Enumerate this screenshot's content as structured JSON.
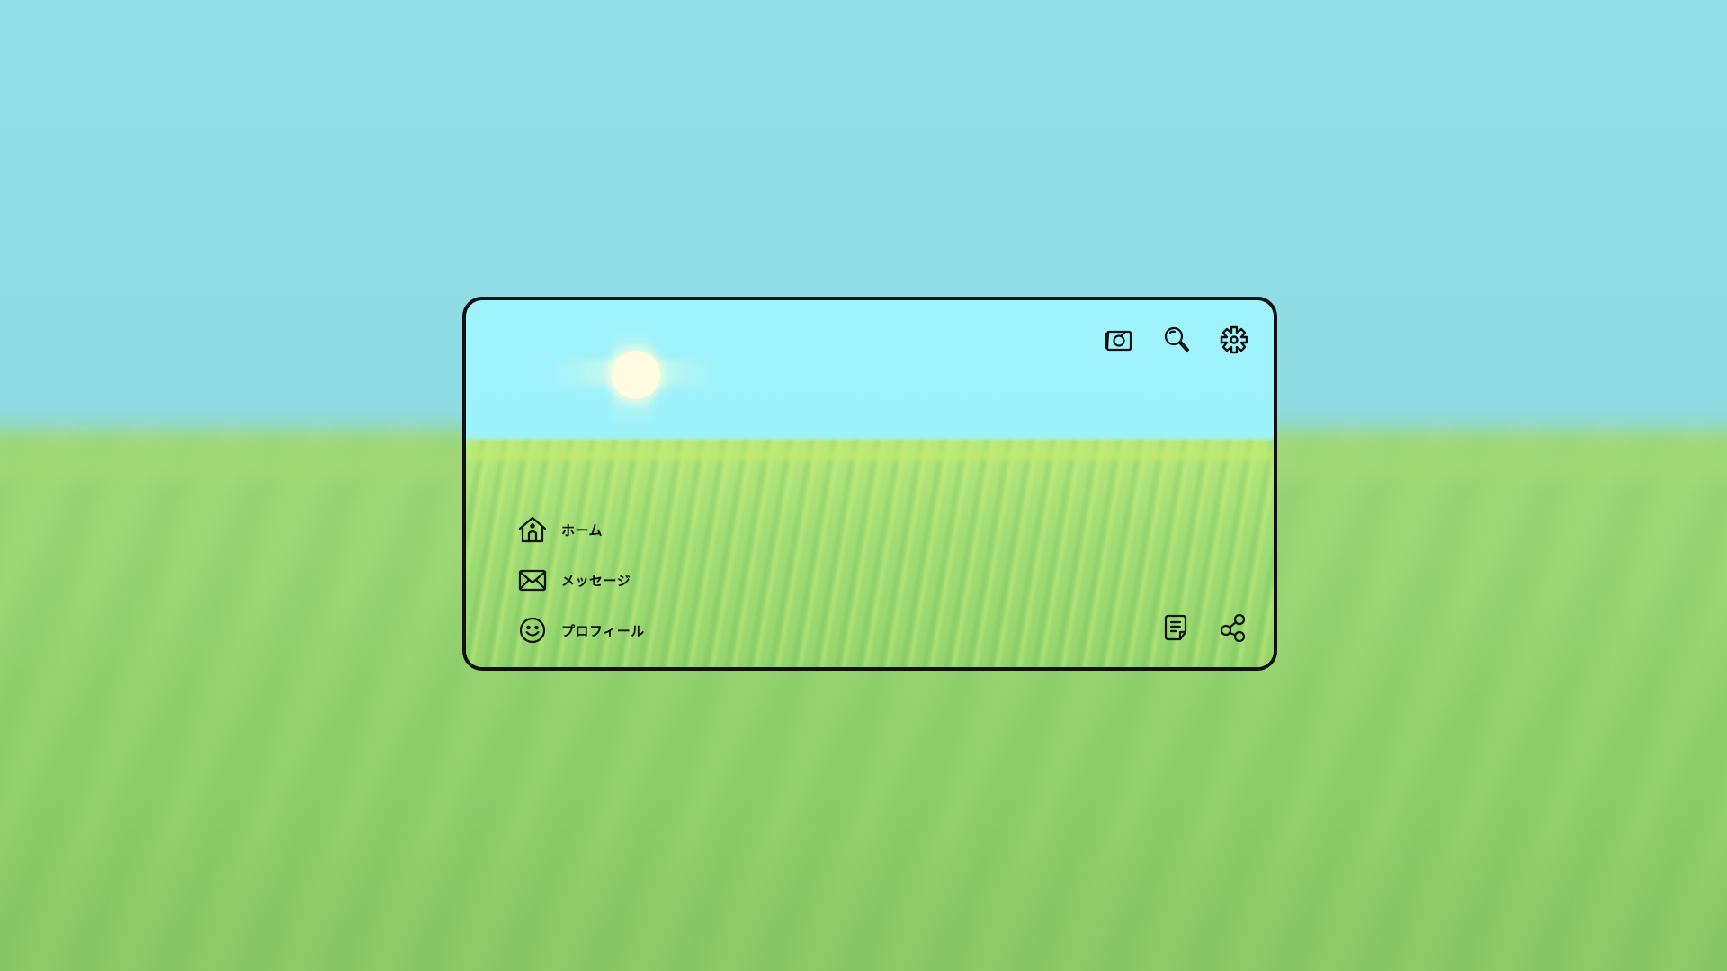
{
  "nav": {
    "items": [
      {
        "label": "ホーム",
        "icon": "home-icon"
      },
      {
        "label": "メッセージ",
        "icon": "mail-icon"
      },
      {
        "label": "プロフィール",
        "icon": "smiley-icon"
      }
    ]
  },
  "toolbar": {
    "top_icons": [
      "camera-icon",
      "search-icon",
      "gear-icon"
    ],
    "bottom_icons": [
      "document-icon",
      "share-icon"
    ]
  },
  "colors": {
    "sky": "#9ef3fc",
    "grass": "#9dde74",
    "border": "#111111",
    "sun": "#fffbe0"
  }
}
